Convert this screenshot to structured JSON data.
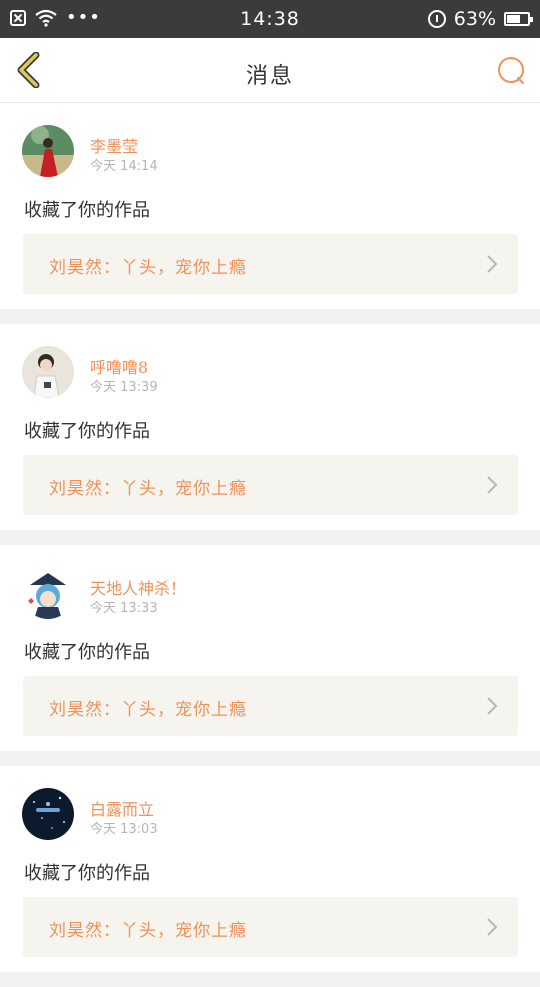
{
  "status_bar": {
    "time": "14:38",
    "battery": "63%",
    "battery_level": 0.63
  },
  "header": {
    "title": "消息",
    "back_icon": "chevron-left-icon",
    "search_icon": "search-icon",
    "accent_color": "#f0915a"
  },
  "messages": [
    {
      "username": "李墨莹",
      "time": "今天 14:14",
      "action": "收藏了你的作品",
      "quote": "刘昊然：丫头，宠你上瘾"
    },
    {
      "username": "呼噜噜8",
      "time": "今天 13:39",
      "action": "收藏了你的作品",
      "quote": "刘昊然：丫头，宠你上瘾"
    },
    {
      "username": "天地人神杀！",
      "time": "今天 13:33",
      "action": "收藏了你的作品",
      "quote": "刘昊然：丫头，宠你上瘾"
    },
    {
      "username": "白露而立",
      "time": "今天 13:03",
      "action": "收藏了你的作品",
      "quote": "刘昊然：丫头，宠你上瘾"
    }
  ]
}
